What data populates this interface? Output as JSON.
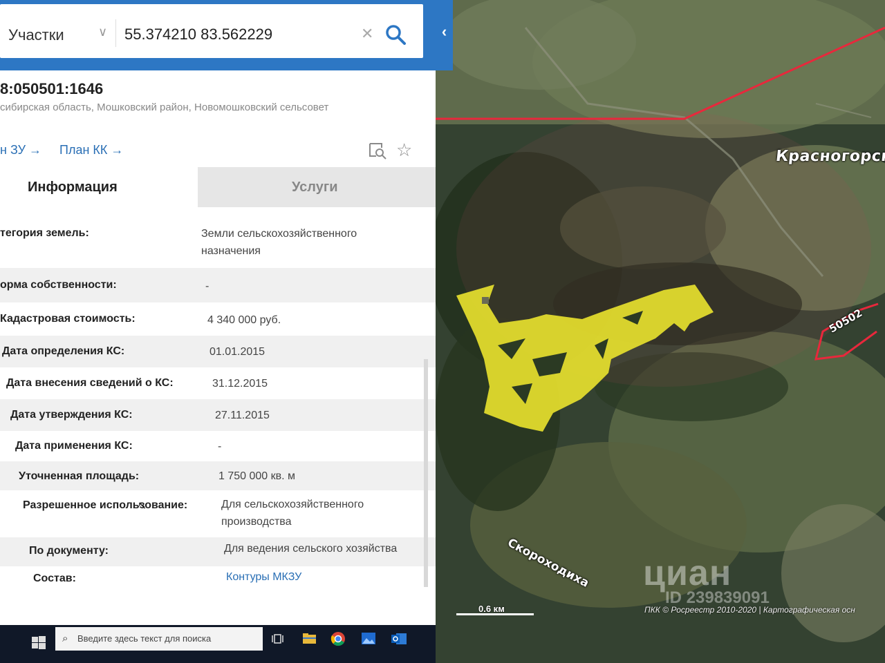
{
  "search": {
    "type_label": "Участки",
    "query": "55.374210 83.562229"
  },
  "parcel": {
    "cad_number": "8:050501:1646",
    "address": "сибирская область, Мошковский район, Новомошковский сельсовет",
    "links": [
      "н ЗУ →",
      "План КК →"
    ]
  },
  "tabs": [
    "Информация",
    "Услуги"
  ],
  "info_rows": [
    {
      "key": "тегория земель:",
      "value": "Земли сельскохозяйственного назначения"
    },
    {
      "key": "орма собственности:",
      "value": "-"
    },
    {
      "key": "Кадастровая стоимость:",
      "value": "4 340 000 руб."
    },
    {
      "key": "Дата определения КС:",
      "value": "01.01.2015"
    },
    {
      "key": "Дата внесения сведений о КС:",
      "value": "31.12.2015"
    },
    {
      "key": "Дата утверждения КС:",
      "value": "27.11.2015"
    },
    {
      "key": "Дата применения КС:",
      "value": "-"
    },
    {
      "key": "Уточненная площадь:",
      "value": "1 750 000 кв. м"
    },
    {
      "key": "Разрешенное использование:",
      "value": "Для сельскохозяйственного производства"
    },
    {
      "key": "По документу:",
      "value": "Для ведения сельского хозяйства"
    },
    {
      "key": "Состав:",
      "value": "Контуры МКЗУ"
    }
  ],
  "map": {
    "label_settlement": "Красногорский",
    "label_river": "Скороходиха",
    "label_block": "50502",
    "scale": "0.6 км",
    "copyright": "ПКК © Росреестр 2010-2020 | Картографическая осн",
    "watermark_logo": "циан",
    "watermark_id": "ID 239839091",
    "parcel_color": "#e6df2e",
    "boundary_color": "#e8283c"
  },
  "taskbar": {
    "search_placeholder": "Введите здесь текст для поиска"
  }
}
